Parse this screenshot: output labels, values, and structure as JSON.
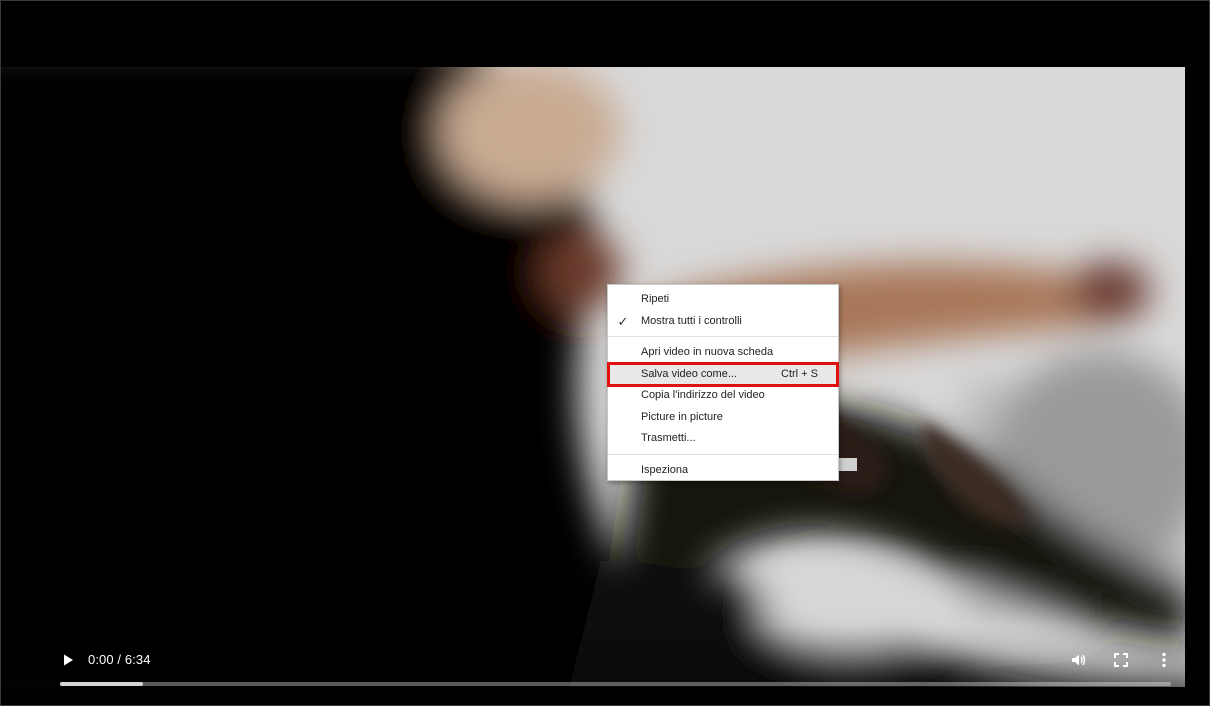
{
  "video": {
    "time_display": "0:00 / 6:34",
    "progress_buffered": 0.075
  },
  "icons": {
    "play": "play-icon",
    "volume": "volume-icon",
    "fullscreen": "fullscreen-icon",
    "more": "more-vertical-icon",
    "check": "checkmark-icon"
  },
  "context_menu": {
    "group1": [
      {
        "label": "Ripeti",
        "checked": false
      },
      {
        "label": "Mostra tutti i controlli",
        "checked": true
      }
    ],
    "group2": [
      {
        "label": "Apri video in nuova scheda"
      },
      {
        "label": "Salva video come...",
        "shortcut": "Ctrl + S",
        "highlighted": true
      },
      {
        "label": "Copia l'indirizzo del video"
      },
      {
        "label": "Picture in picture"
      },
      {
        "label": "Trasmetti..."
      }
    ],
    "group3": [
      {
        "label": "Ispeziona"
      }
    ]
  },
  "colors": {
    "highlight_border": "#e01010",
    "menu_bg": "#ffffff",
    "control_fg": "#ffffff"
  }
}
